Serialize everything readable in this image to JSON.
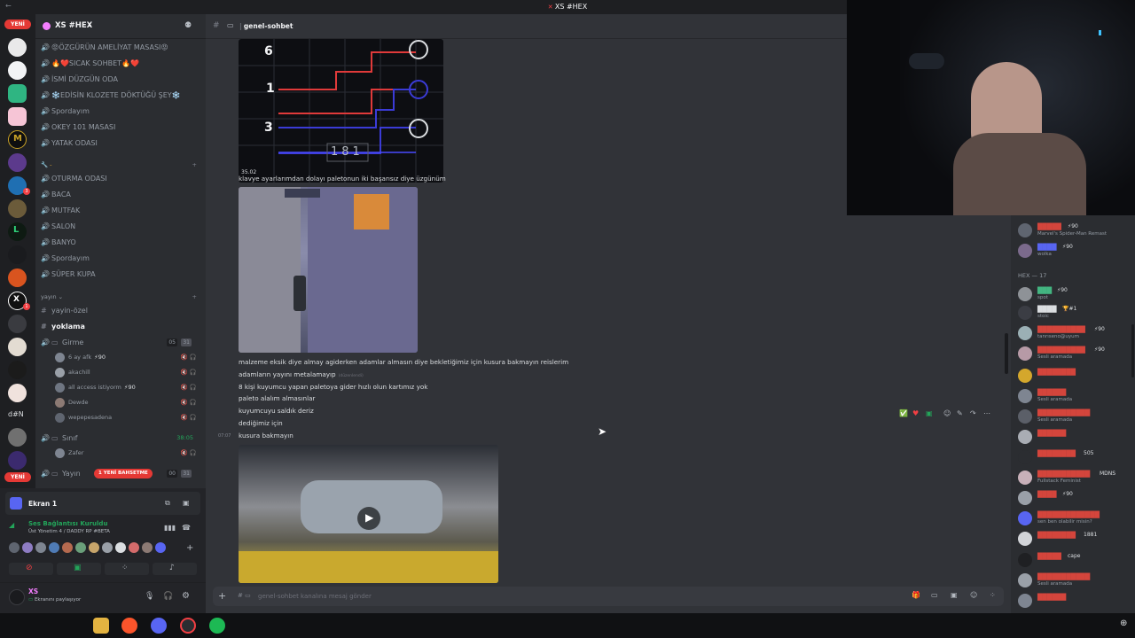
{
  "window": {
    "title": "XS #HEX"
  },
  "guilds": {
    "new_top": "YENİ",
    "new_bottom": "YENİ",
    "text_server": "d#N",
    "badges": [
      "3",
      "1"
    ]
  },
  "server": {
    "name": "XS #HEX",
    "chevron": "⌄"
  },
  "channels_top": [
    {
      "icon": "speaker-icon",
      "name": "😡ÖZGÜRÜN AMELİYAT MASASI😡"
    },
    {
      "icon": "speaker-icon",
      "name": "🔥❤️SICAK SOHBET🔥❤️"
    },
    {
      "icon": "speaker-icon",
      "name": "İSMİ DÜZGÜN ODA"
    },
    {
      "icon": "speaker-icon",
      "name": "❄️EDİSİN KLOZETE DÖKTÜĞÜ ŞEY❄️"
    },
    {
      "icon": "speaker-icon",
      "name": "Spordayım"
    },
    {
      "icon": "speaker-icon",
      "name": "OKEY 101 MASASI"
    },
    {
      "icon": "speaker-icon",
      "name": "YATAK ODASI"
    }
  ],
  "category_tools": "🔧 -",
  "channels_mid": [
    {
      "icon": "speaker-icon",
      "name": "OTURMA ODASI"
    },
    {
      "icon": "speaker-icon",
      "name": "BACA"
    },
    {
      "icon": "speaker-icon",
      "name": "MUTFAK"
    },
    {
      "icon": "speaker-icon",
      "name": "SALON"
    },
    {
      "icon": "speaker-icon",
      "name": "BANYO"
    },
    {
      "icon": "speaker-icon",
      "name": "Spordayım"
    },
    {
      "icon": "speaker-icon",
      "name": "SÜPER KUPA"
    }
  ],
  "category_yayin": "yayın",
  "channels_yayin": [
    {
      "icon": "hash-icon",
      "name": "yayin-özel",
      "active": false
    },
    {
      "icon": "hash-icon",
      "name": "yoklama",
      "active": true
    }
  ],
  "voice_girme": {
    "name": "Girme",
    "counter_a": "05",
    "counter_b": "31"
  },
  "voice_users_girme": [
    {
      "name": "6 ay afk",
      "badge": "⚡90",
      "color": "#8e9297"
    },
    {
      "name": "akachill",
      "badge": "",
      "color": "#8e9297"
    },
    {
      "name": "all access istiyorm",
      "badge": "⚡90",
      "color": "#8e9297"
    },
    {
      "name": "Dewde",
      "badge": "",
      "color": "#8e9297"
    },
    {
      "name": "wepepesadena",
      "badge": "",
      "color": "#8e9297"
    }
  ],
  "voice_sinif": {
    "name": "Sınıf",
    "timer": "38:05"
  },
  "voice_users_sinif": [
    {
      "name": "Zafer",
      "badge": "",
      "color": "#8e9297"
    }
  ],
  "voice_yayin": {
    "name": "Yayın",
    "pill": "1 YENİ BAHSETME",
    "counter_a": "00",
    "counter_b": "31"
  },
  "panel": {
    "screen_name": "Ekran 1",
    "connection_status": "Ses Bağlantısı Kuruldu",
    "connection_detail": "Üst Yönetim 4 / DADDY RP #BETA",
    "user_name": "XS",
    "user_status": "Ekranını paylaşıyor"
  },
  "chat": {
    "channel_name": "genel-sohbet",
    "messages": [
      "klavye ayarlarımdan dolayı paletonun iki başarısız diye üzgünüm",
      "malzeme eksik diye almay agiderken adamlar almasın diye bekletiğimiz için kusura bakmayın reislerim",
      "adamların yayını metalamayıp",
      "8 kişi kuyumcu yapan paletoya gider hızlı olun kartımız yok",
      "paleto alalım almasınlar",
      "kuyumcuyu saldık deriz",
      "dediğimiz için",
      "kusura bakmayın"
    ],
    "edited_tag": "(düzenlendi)",
    "timestamp": "07:07",
    "game_timer": "35.02",
    "game_numbers": [
      "6",
      "1",
      "3"
    ],
    "game_counter": "181",
    "composer_placeholder": "genel-sohbet kanalına mesaj gönder"
  },
  "members": {
    "group_label": "HEX — 17",
    "list": [
      {
        "name": "█████",
        "status": "Marvel's Spider-Man Remast",
        "badge": "⚡90",
        "color": "#d4453c"
      },
      {
        "name": "████",
        "status": "wolka",
        "badge": "⚡90",
        "color": "#5865f2"
      },
      {
        "name": "███",
        "status": "spot",
        "badge": "⚡90",
        "color": "#43b581"
      },
      {
        "name": "████",
        "status": "stoic",
        "badge": "🏆#1",
        "color": "#dbdee1"
      },
      {
        "name": "██████████",
        "status": "tanrıseno@uyum",
        "badge": "⚡90",
        "color": "#d4453c"
      },
      {
        "name": "██████████",
        "status": "Sesli aramada",
        "badge": "⚡90",
        "color": "#d4453c"
      },
      {
        "name": "████████",
        "status": "",
        "badge": "",
        "color": "#d4453c"
      },
      {
        "name": "██████",
        "status": "Sesli aramada",
        "badge": "",
        "color": "#d4453c"
      },
      {
        "name": "███████████",
        "status": "Sesli aramada",
        "badge": "",
        "color": "#d4453c"
      },
      {
        "name": "██████",
        "status": "",
        "badge": "",
        "color": "#d4453c"
      },
      {
        "name": "████████",
        "status": "",
        "badge": "505",
        "color": "#d4453c"
      },
      {
        "name": "███████████",
        "status": "Fullstack Feminist",
        "badge": "MDNS",
        "color": "#d4453c"
      },
      {
        "name": "████",
        "status": "",
        "badge": "⚡90",
        "color": "#d4453c"
      },
      {
        "name": "█████████████",
        "status": "sen ben olabilir misin?",
        "badge": "",
        "color": "#d4453c"
      },
      {
        "name": "████████",
        "status": "",
        "badge": "1881",
        "color": "#d4453c"
      },
      {
        "name": "█████",
        "status": "",
        "badge": "cape",
        "color": "#d4453c"
      },
      {
        "name": "███████████",
        "status": "Sesli aramada",
        "badge": "",
        "color": "#d4453c"
      },
      {
        "name": "██████",
        "status": "",
        "badge": "",
        "color": "#d4453c"
      }
    ]
  },
  "colors": {
    "accent": "#5865f2",
    "voice_green": "#23a55a",
    "alert_red": "#f23f43"
  }
}
